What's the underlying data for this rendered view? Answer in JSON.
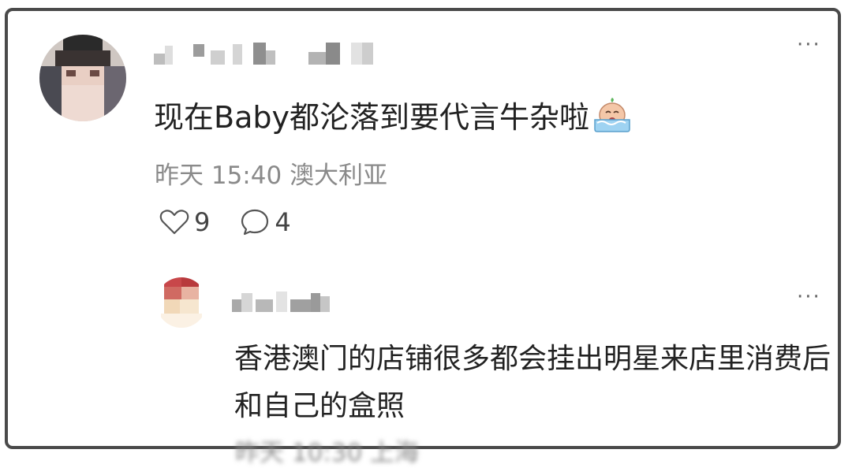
{
  "comment": {
    "text": "现在Baby都沦落到要代言牛杂啦",
    "emoji_icon": "crying-face-emoji",
    "time": "昨天 15:40",
    "location": "澳大利亚",
    "likes": "9",
    "replies": "4",
    "more_label": "···"
  },
  "reply": {
    "text": "香港澳门的店铺很多都会挂出明星来店里消费后和自己的盒照",
    "more_label": "···",
    "meta_partial": "昨天 10:30 上海"
  },
  "colors": {
    "border": "#4a4a4a",
    "meta_text": "#8a8a8a",
    "body_text": "#222222"
  }
}
